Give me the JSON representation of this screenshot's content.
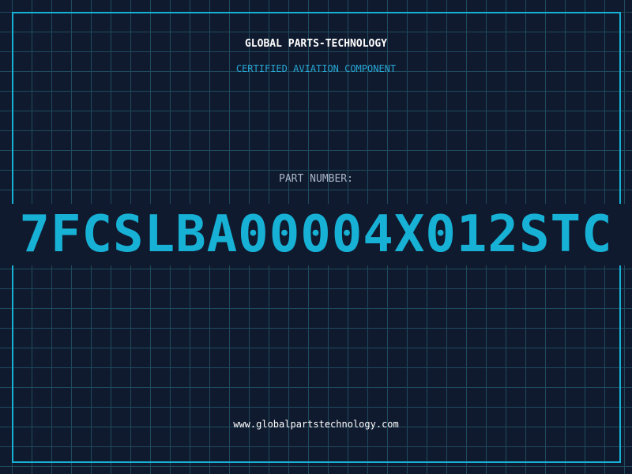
{
  "header": {
    "title": "GLOBAL PARTS-TECHNOLOGY",
    "subtitle": "CERTIFIED AVIATION COMPONENT"
  },
  "part": {
    "label": "PART NUMBER:",
    "number": "7FCSLBA00004X012STC"
  },
  "footer": {
    "url": "www.globalpartstechnology.com"
  },
  "colors": {
    "background": "#101a2e",
    "grid": "#1f4a5c",
    "accent": "#17b1d6",
    "label": "#a9b6c8",
    "text": "#ffffff"
  }
}
